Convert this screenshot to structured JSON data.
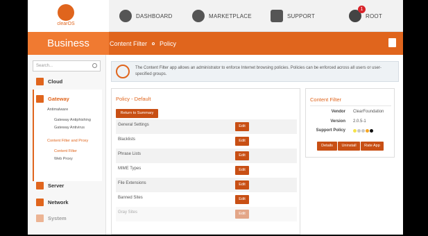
{
  "app": {
    "logo_text": "clearOS",
    "section": "Business"
  },
  "topnav": [
    {
      "label": "DASHBOARD",
      "icon": "dashboard-gauge-icon"
    },
    {
      "label": "MARKETPLACE",
      "icon": "cloud-download-icon"
    },
    {
      "label": "SUPPORT",
      "icon": "support-icon"
    },
    {
      "label": "ROOT",
      "icon": "tools-icon",
      "badge": "1"
    }
  ],
  "breadcrumb": {
    "item1": "Content Filter",
    "item2": "Policy"
  },
  "sidebar": {
    "search_placeholder": "Search...",
    "categories": [
      {
        "label": "Cloud"
      },
      {
        "label": "Gateway"
      },
      {
        "label": "Server"
      },
      {
        "label": "Network"
      },
      {
        "label": "System"
      }
    ],
    "gateway_groups": [
      {
        "label": "Antimalware",
        "items": [
          "Gateway Antiphishing",
          "Gateway Antivirus"
        ]
      },
      {
        "label": "Content Filter and Proxy",
        "items": [
          "Content Filter",
          "Web Proxy"
        ]
      }
    ]
  },
  "info": {
    "text": "The Content Filter app allows an administrator to enforce Internet browsing policies. Policies can be enforced across all users or user-specified groups."
  },
  "policy": {
    "title": "Policy - Default",
    "return_label": "Return to Summary",
    "edit_label": "Edit",
    "rows": [
      "General Settings",
      "Blacklists",
      "Phrase Lists",
      "MIME Types",
      "File Extensions",
      "Banned Sites",
      "Gray Sites"
    ]
  },
  "content_filter": {
    "title": "Content Filter",
    "vendor_label": "Vendor",
    "vendor_value": "ClearFoundation",
    "version_label": "Version",
    "version_value": "2.0.5-1",
    "support_label": "Support Policy",
    "support_dot_colors": [
      "#f5e34a",
      "#c8c8c8",
      "#c8c8c8",
      "#f5a623",
      "#111111"
    ],
    "buttons": [
      "Details",
      "Uninstall",
      "Rate App"
    ]
  },
  "colors": {
    "accent": "#e0651d",
    "button": "#c84f14"
  }
}
